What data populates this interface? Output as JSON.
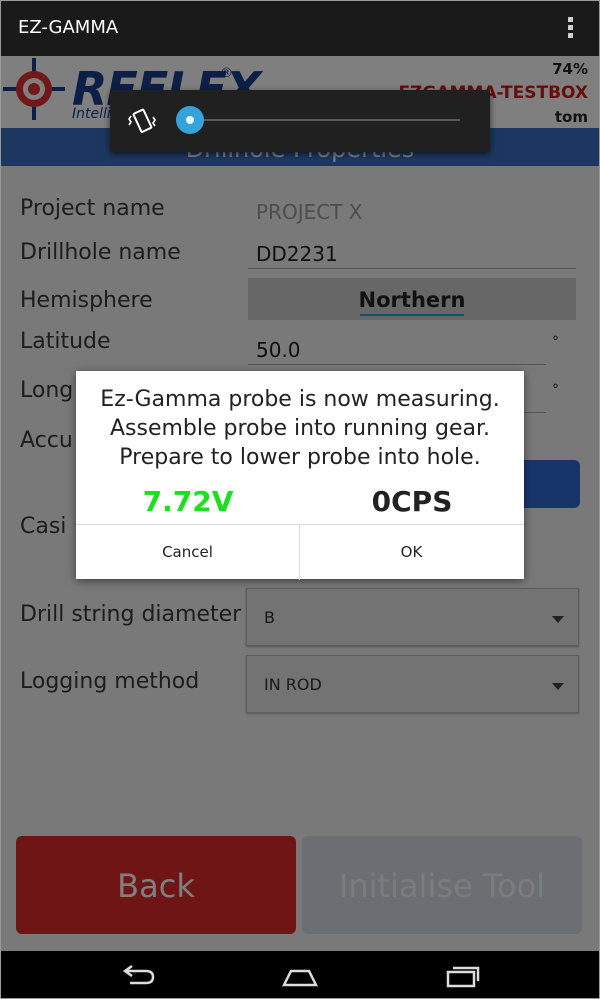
{
  "action_bar": {
    "title": "EZ-GAMMA",
    "overflow_icon": "more-vertical-icon"
  },
  "header": {
    "logo_text": "REFLEX",
    "logo_registered": "®",
    "logo_tagline": "Intelli",
    "battery": "74%",
    "device_id": "EZGAMMA-TESTBOX",
    "user": "tom",
    "section_title": "Drillhole Properties"
  },
  "form": {
    "project_name": {
      "label": "Project name",
      "value": "PROJECT X"
    },
    "drillhole_name": {
      "label": "Drillhole name",
      "value": "DD2231"
    },
    "hemisphere": {
      "label": "Hemisphere",
      "value": "Northern"
    },
    "latitude": {
      "label": "Latitude",
      "value": "50.0",
      "unit": "°"
    },
    "longitude": {
      "label": "Long",
      "unit": "°"
    },
    "accuracy": {
      "label": "Accu"
    },
    "casing": {
      "label": "Casi"
    },
    "drill_string_diameter": {
      "label": "Drill string diameter",
      "value": "B"
    },
    "logging_method": {
      "label": "Logging method",
      "value": "IN ROD"
    }
  },
  "buttons": {
    "back": "Back",
    "initialise": "Initialise Tool"
  },
  "volume_popup": {
    "icon": "vibrate-icon",
    "level": 0
  },
  "dialog": {
    "message_line1": "Ez-Gamma probe is now measuring.",
    "message_line2": "Assemble probe into running gear.",
    "message_line3": "Prepare to lower probe into hole.",
    "voltage": "7.72V",
    "cps": "0CPS",
    "cancel": "Cancel",
    "ok": "OK"
  },
  "nav_bar": {
    "back_icon": "back-icon",
    "home_icon": "home-icon",
    "recents_icon": "recents-icon"
  },
  "colors": {
    "voltage": "#1de01d",
    "device_id": "#d11a1a",
    "header_blue": "#3a6ec3",
    "back_button": "#e12a2a"
  }
}
